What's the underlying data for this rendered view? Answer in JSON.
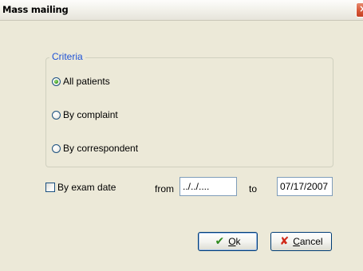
{
  "window": {
    "title": "Mass mailing",
    "close_glyph": "×"
  },
  "criteria": {
    "legend": "Criteria",
    "options": [
      {
        "label": "All patients",
        "checked": true
      },
      {
        "label": "By complaint",
        "checked": false
      },
      {
        "label": "By correspondent",
        "checked": false
      }
    ]
  },
  "exam_date": {
    "checkbox_label": "By exam date",
    "checked": false,
    "from_label": "from",
    "from_value": "../../....",
    "to_label": "to",
    "to_value": "07/17/2007"
  },
  "buttons": {
    "ok_prefix": "",
    "ok_accel": "O",
    "ok_rest": "k",
    "cancel_accel": "C",
    "cancel_rest": "ancel",
    "ok_icon": "check-icon",
    "cancel_icon": "x-icon"
  },
  "colors": {
    "background": "#ece9d8",
    "legend_text": "#1e52d6",
    "textbox_border": "#7f9db9",
    "ok_icon": "#2e8a1e",
    "cancel_icon": "#d02a1a"
  }
}
